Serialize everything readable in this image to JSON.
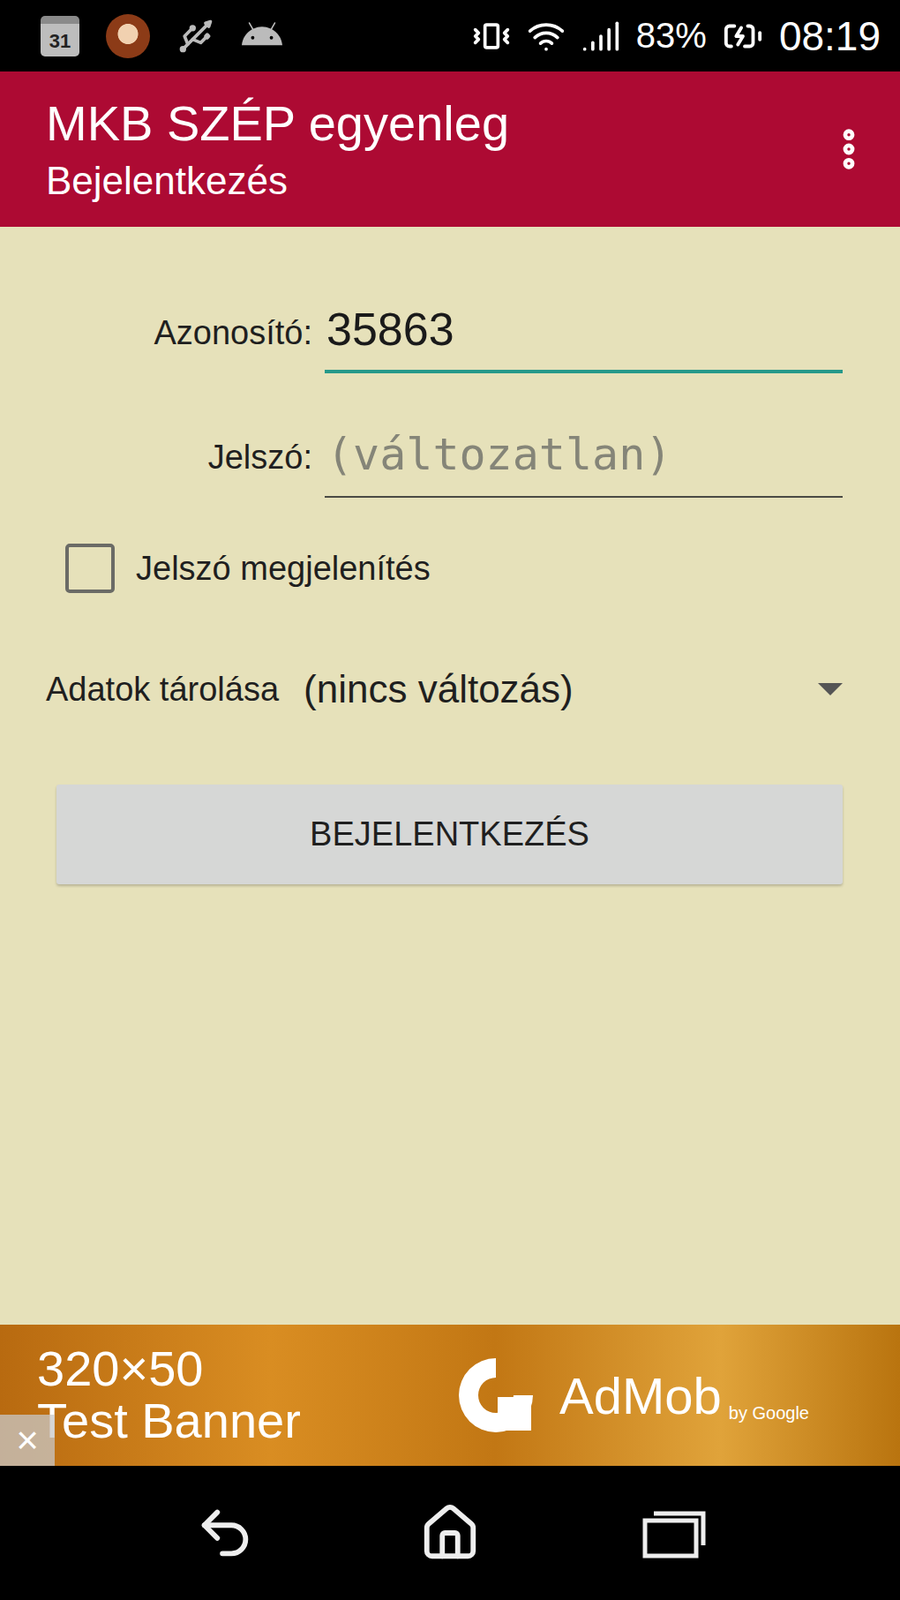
{
  "status_bar": {
    "calendar_day": "31",
    "battery": "83%",
    "time": "08:19"
  },
  "app_bar": {
    "title": "MKB SZÉP egyenleg",
    "subtitle": "Bejelentkezés"
  },
  "form": {
    "fields": [
      {
        "label": "Azonosító:",
        "value": "35863",
        "placeholder": "",
        "focused": true,
        "kind": "text"
      },
      {
        "label": "Jelszó:",
        "value": "",
        "placeholder": "(változatlan)",
        "focused": false,
        "kind": "password"
      }
    ],
    "show_password": {
      "label": "Jelszó megjelenítés",
      "checked": false
    },
    "storage": {
      "label": "Adatok tárolása",
      "value": "(nincs változás)"
    },
    "submit": "BEJELENTKEZÉS"
  },
  "ad": {
    "size": "320×50",
    "text": "Test Banner",
    "brand": "AdMob",
    "byline": "by Google",
    "close": "×"
  }
}
